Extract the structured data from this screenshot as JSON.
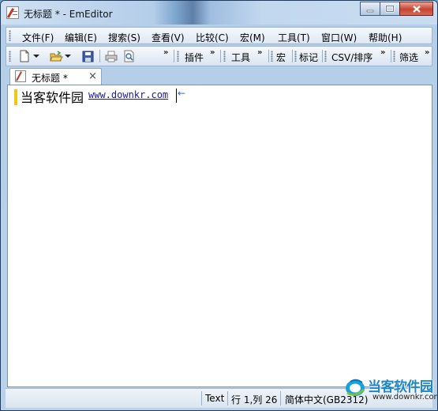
{
  "window": {
    "title": "无标题 * - EmEditor"
  },
  "menubar": {
    "items": [
      {
        "label": "文件(F)"
      },
      {
        "label": "编辑(E)"
      },
      {
        "label": "搜索(S)"
      },
      {
        "label": "查看(V)"
      },
      {
        "label": "比较(C)"
      },
      {
        "label": "宏(M)"
      },
      {
        "label": "工具(T)"
      },
      {
        "label": "窗口(W)"
      },
      {
        "label": "帮助(H)"
      }
    ]
  },
  "toolbar": {
    "buttons": [
      "new-file-icon",
      "dropdown-arrow-icon",
      "open-folder-icon",
      "dropdown-arrow-icon",
      "save-icon",
      "print-icon",
      "print-preview-icon"
    ],
    "plugins_label": "插件",
    "tools_label": "工具",
    "macros_label": "宏",
    "marks_label": "标记",
    "csv_label": "CSV/排序",
    "filter_label": "筛选",
    "overflow_glyph": "»"
  },
  "tabs": [
    {
      "label": "无标题 *",
      "close_glyph": "×"
    }
  ],
  "editor": {
    "line_text": "当客软件园",
    "line_url": "www.downkr.com",
    "eol_glyph": "←"
  },
  "statusbar": {
    "mode": "Text",
    "position": "行 1,列 26",
    "encoding": "简体中文(GB2312)"
  },
  "watermark": {
    "title": "当客软件园",
    "url": "www.downkr.com"
  },
  "colors": {
    "accent": "#1d86c9",
    "url_link": "#1a1aa6",
    "line_marker": "#f2c80f",
    "close_button": "#c74231"
  }
}
